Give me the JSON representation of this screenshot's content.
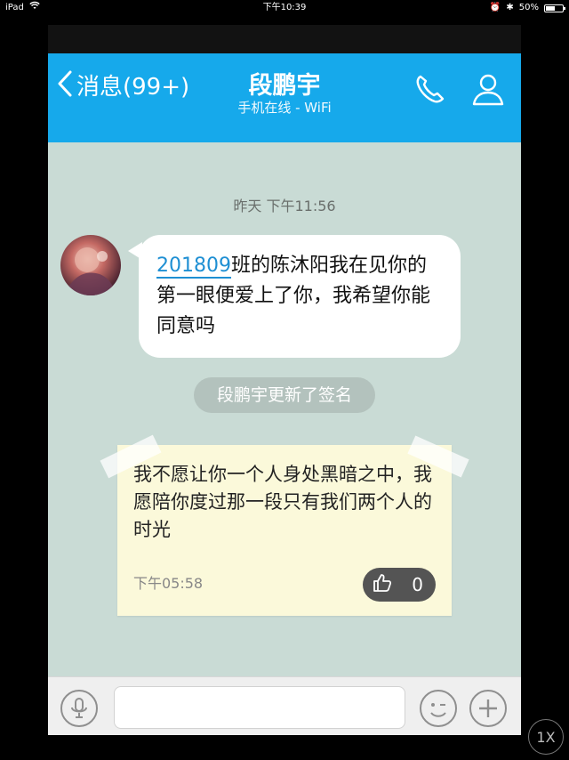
{
  "status_bar": {
    "device": "iPad",
    "time": "下午10:39",
    "battery": "50%",
    "wifi_icon": "wifi-icon",
    "battery_icon": "battery-icon"
  },
  "header": {
    "back_label": "消息(99+)",
    "title": "段鹏宇",
    "subtitle": "手机在线 - WiFi",
    "call_icon": "phone-icon",
    "profile_icon": "person-icon",
    "background_color": "#16a9eb"
  },
  "chat": {
    "timestamp": "昨天 下午11:56",
    "message_prefix": "201809",
    "message_rest": "班的陈沐阳我在见你的第一眼便爱上了你，我希望你能同意吗",
    "system_note": "段鹏宇更新了签名",
    "signature_card": {
      "text": "我不愿让你一个人身处黑暗之中，我愿陪你度过那一段只有我们两个人的时光",
      "time": "下午05:58",
      "like_count": "0"
    },
    "background_color": "#c9dbd5"
  },
  "input_bar": {
    "voice_icon": "microphone-icon",
    "emoji_icon": "emoji-icon",
    "more_icon": "plus-icon",
    "placeholder": ""
  },
  "overlay": {
    "zoom_label": "1X"
  }
}
